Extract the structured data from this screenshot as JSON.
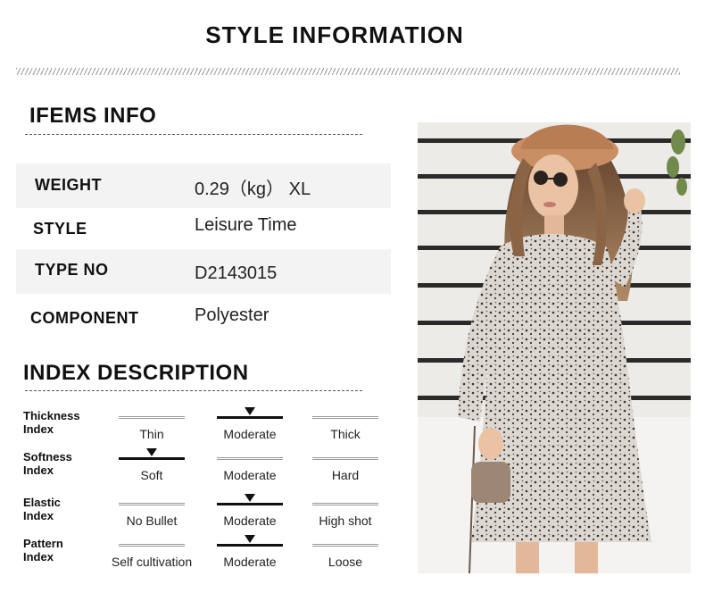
{
  "header": {
    "title": "STYLE INFORMATION"
  },
  "items_info": {
    "title": "IFEMS INFO",
    "rows": [
      {
        "label": "WEIGHT",
        "value": "0.29（kg） XL"
      },
      {
        "label": "STYLE",
        "value": "Leisure Time"
      },
      {
        "label": "TYPE NO",
        "value": "D2143015"
      },
      {
        "label": "COMPONENT",
        "value": "Polyester"
      }
    ]
  },
  "index_description": {
    "title": "INDEX DESCRIPTION",
    "rows": [
      {
        "label_line1": "Thickness",
        "label_line2": "Index",
        "options": [
          "Thin",
          "Moderate",
          "Thick"
        ],
        "selected": 1
      },
      {
        "label_line1": "Softness",
        "label_line2": "Index",
        "options": [
          "Soft",
          "Moderate",
          "Hard"
        ],
        "selected": 0
      },
      {
        "label_line1": "Elastic",
        "label_line2": "Index",
        "options": [
          "No Bullet",
          "Moderate",
          "High shot"
        ],
        "selected": 1
      },
      {
        "label_line1": "Pattern",
        "label_line2": "Index",
        "options": [
          "Self cultivation",
          "Moderate",
          "Loose"
        ],
        "selected": 1
      }
    ]
  },
  "photo": {
    "subject": "model-in-leopard-print-dress-icon"
  }
}
